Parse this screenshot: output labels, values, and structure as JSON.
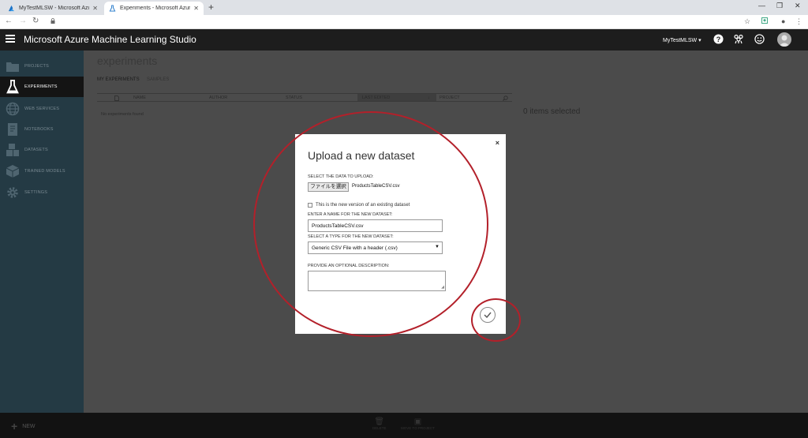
{
  "browser": {
    "tabs": [
      {
        "title": "MyTestMLSW - Microsoft Azure",
        "active": false
      },
      {
        "title": "Experiments - Microsoft Azure M",
        "active": true
      }
    ]
  },
  "app": {
    "title": "Microsoft Azure Machine Learning Studio",
    "workspace": "MyTestMLSW ▾"
  },
  "sidebar": {
    "items": [
      {
        "label": "PROJECTS",
        "icon": "folder-icon"
      },
      {
        "label": "EXPERIMENTS",
        "icon": "flask-icon"
      },
      {
        "label": "WEB SERVICES",
        "icon": "globe-icon"
      },
      {
        "label": "NOTEBOOKS",
        "icon": "notebook-icon"
      },
      {
        "label": "DATASETS",
        "icon": "cubes-icon"
      },
      {
        "label": "TRAINED MODELS",
        "icon": "box-icon"
      },
      {
        "label": "SETTINGS",
        "icon": "gear-icon"
      }
    ]
  },
  "main": {
    "title": "experiments",
    "tabs": [
      "MY EXPERIMENTS",
      "SAMPLES"
    ],
    "columns": [
      "NAME",
      "AUTHOR",
      "STATUS",
      "LAST EDITED",
      "PROJECT"
    ],
    "empty_message": "No experiments found",
    "selection": "0 items selected"
  },
  "bottom": {
    "new_label": "NEW",
    "delete_label": "DELETE",
    "move_label": "MOVE TO PROJECT"
  },
  "dialog": {
    "title": "Upload a new dataset",
    "close": "×",
    "select_label": "SELECT THE DATA TO UPLOAD:",
    "file_button": "ファイルを選択",
    "file_name": "ProductsTableCSV.csv",
    "new_version_label": "This is the new version of an existing dataset",
    "name_label": "ENTER A NAME FOR THE NEW DATASET:",
    "name_value": "ProductsTableCSV.csv",
    "type_label": "SELECT A TYPE FOR THE NEW DATASET:",
    "type_value": "Generic CSV File with a header (.csv)",
    "desc_label": "PROVIDE AN OPTIONAL DESCRIPTION:",
    "desc_value": ""
  },
  "colors": {
    "annotation": "#b3202a",
    "sidebar": "#243a44",
    "header": "#1d1d1d"
  }
}
